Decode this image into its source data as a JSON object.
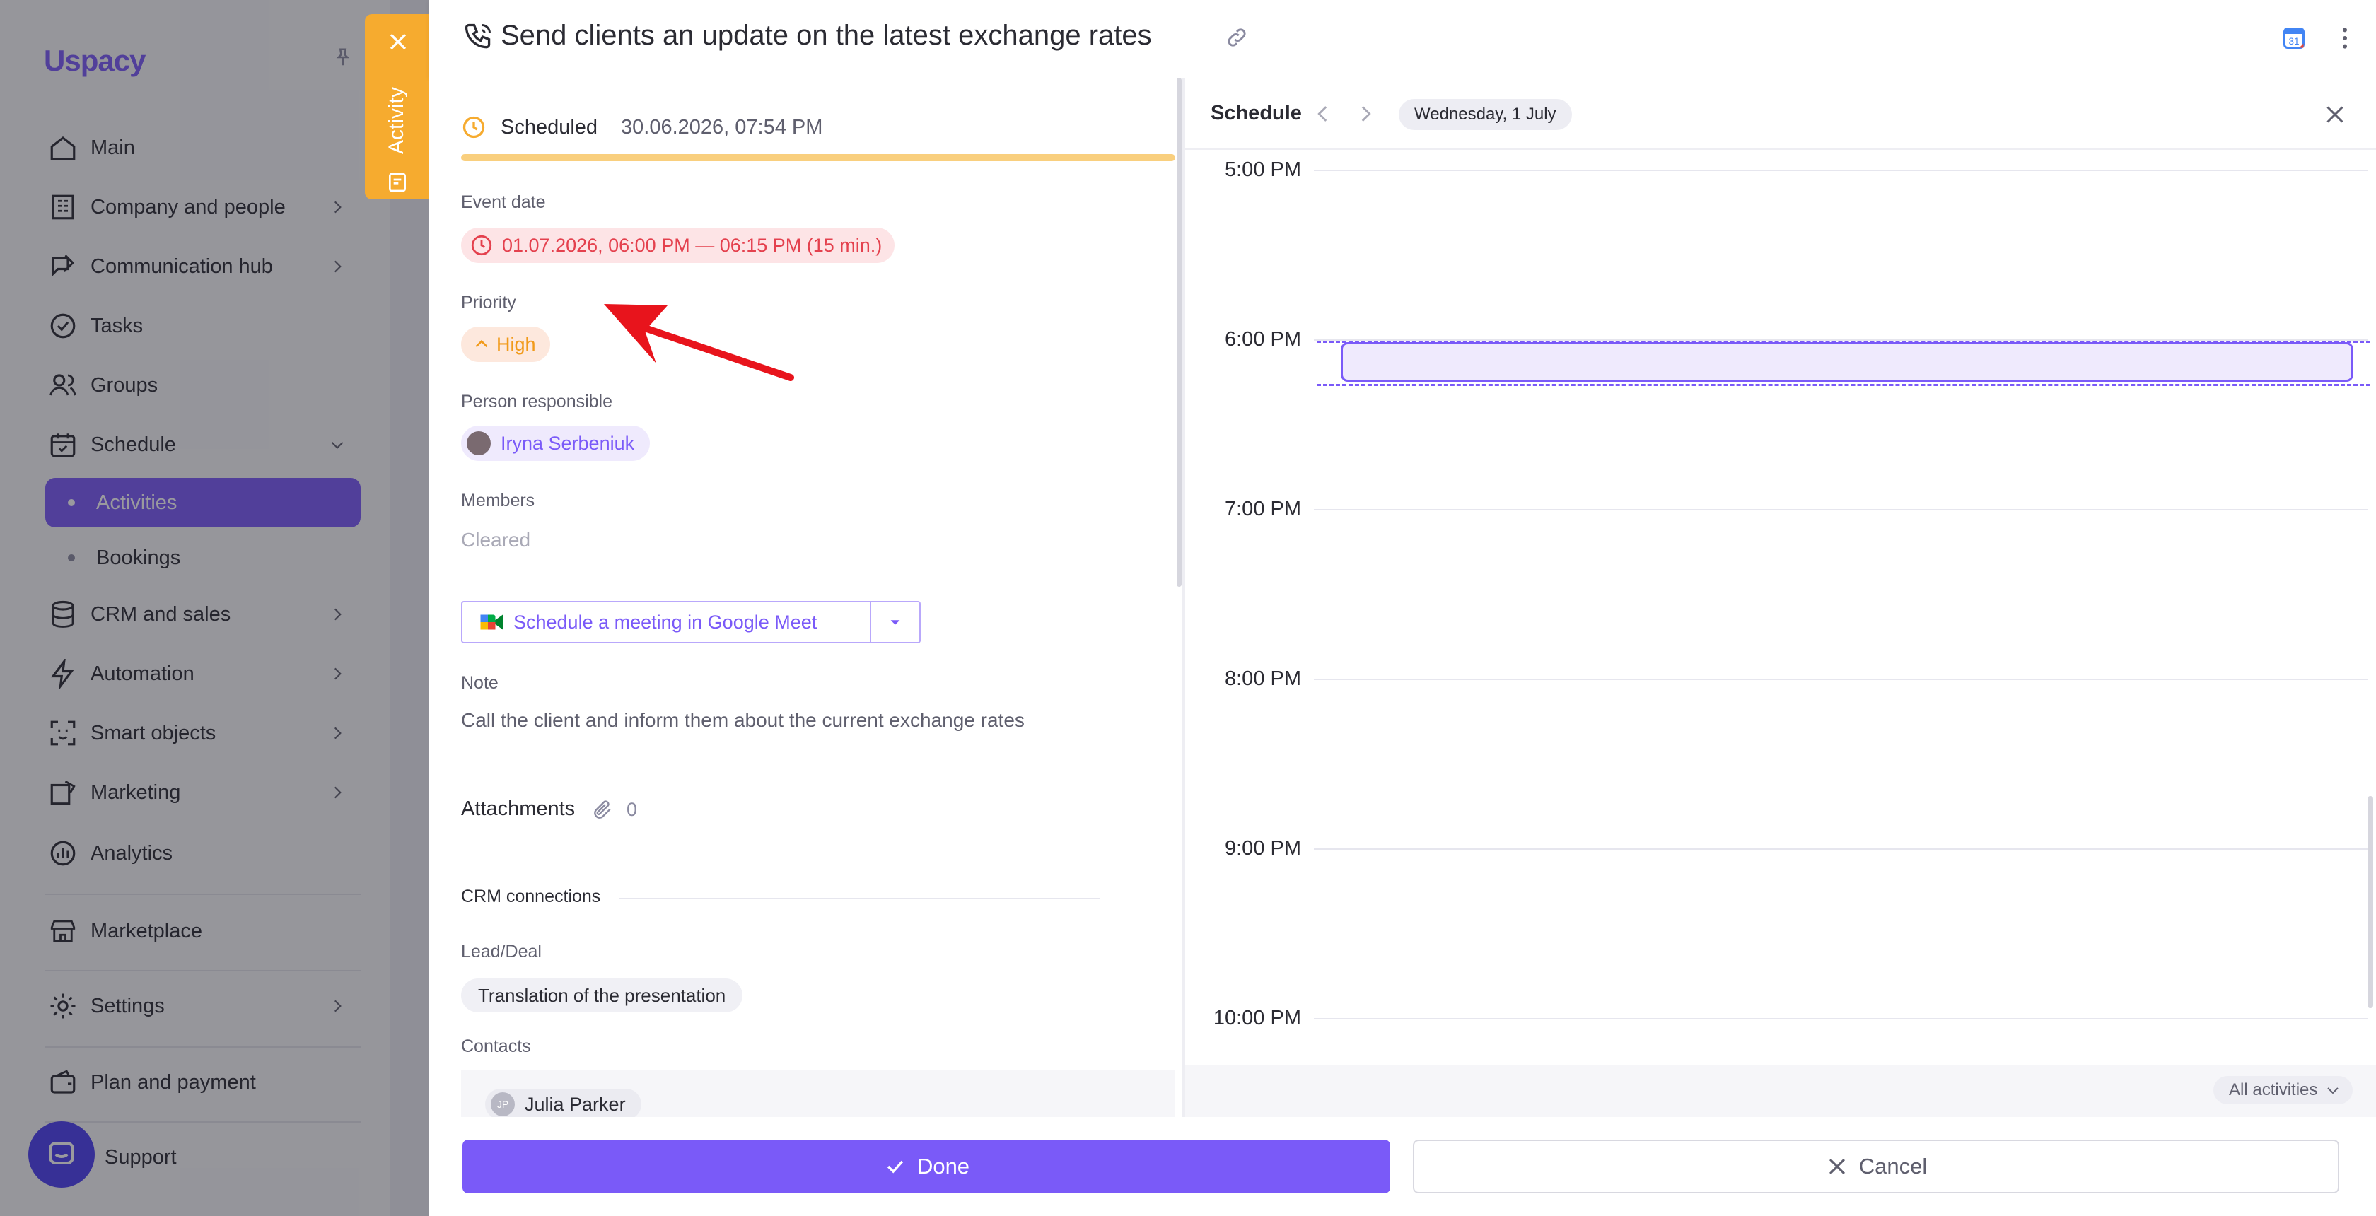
{
  "sidebar": {
    "logo": "Uspacy",
    "items": [
      {
        "label": "Main"
      },
      {
        "label": "Company and people"
      },
      {
        "label": "Communication hub"
      },
      {
        "label": "Tasks"
      },
      {
        "label": "Groups"
      },
      {
        "label": "Schedule"
      },
      {
        "label": "CRM and sales"
      },
      {
        "label": "Automation"
      },
      {
        "label": "Smart objects"
      },
      {
        "label": "Marketing"
      },
      {
        "label": "Analytics"
      },
      {
        "label": "Marketplace"
      },
      {
        "label": "Settings"
      },
      {
        "label": "Plan and payment"
      },
      {
        "label": "Support"
      }
    ],
    "schedule_sub": [
      {
        "label": "Activities"
      },
      {
        "label": "Bookings"
      }
    ]
  },
  "activity_tab": {
    "label": "Activity"
  },
  "header": {
    "title": "Send clients an update on the latest exchange rates"
  },
  "form": {
    "status_label": "Scheduled",
    "status_time": "30.06.2026, 07:54 PM",
    "event_date_label": "Event date",
    "event_date_value": "01.07.2026, 06:00 PM — 06:15 PM (15 min.)",
    "priority_label": "Priority",
    "priority_value": "High",
    "responsible_label": "Person responsible",
    "responsible_value": "Iryna Serbeniuk",
    "members_label": "Members",
    "members_value": "Cleared",
    "meet_button": "Schedule a meeting in Google Meet",
    "note_label": "Note",
    "note_value": "Call the client and inform them about the current exchange rates",
    "attachments_label": "Attachments",
    "attachments_count": "0",
    "crm_label": "CRM connections",
    "lead_label": "Lead/Deal",
    "lead_value": "Translation of the presentation",
    "contacts_label": "Contacts",
    "contact_initials": "JP",
    "contact_value": "Julia Parker"
  },
  "schedule": {
    "title": "Schedule",
    "date": "Wednesday, 1 July",
    "hours": [
      "5:00 PM",
      "6:00 PM",
      "7:00 PM",
      "8:00 PM",
      "9:00 PM",
      "10:00 PM"
    ],
    "filter": "All activities"
  },
  "footer": {
    "done": "Done",
    "cancel": "Cancel"
  },
  "colors": {
    "accent": "#7a5af8",
    "activity_tab": "#f6ab2f",
    "event_date": "#e4414e",
    "priority": "#f19a1a"
  }
}
